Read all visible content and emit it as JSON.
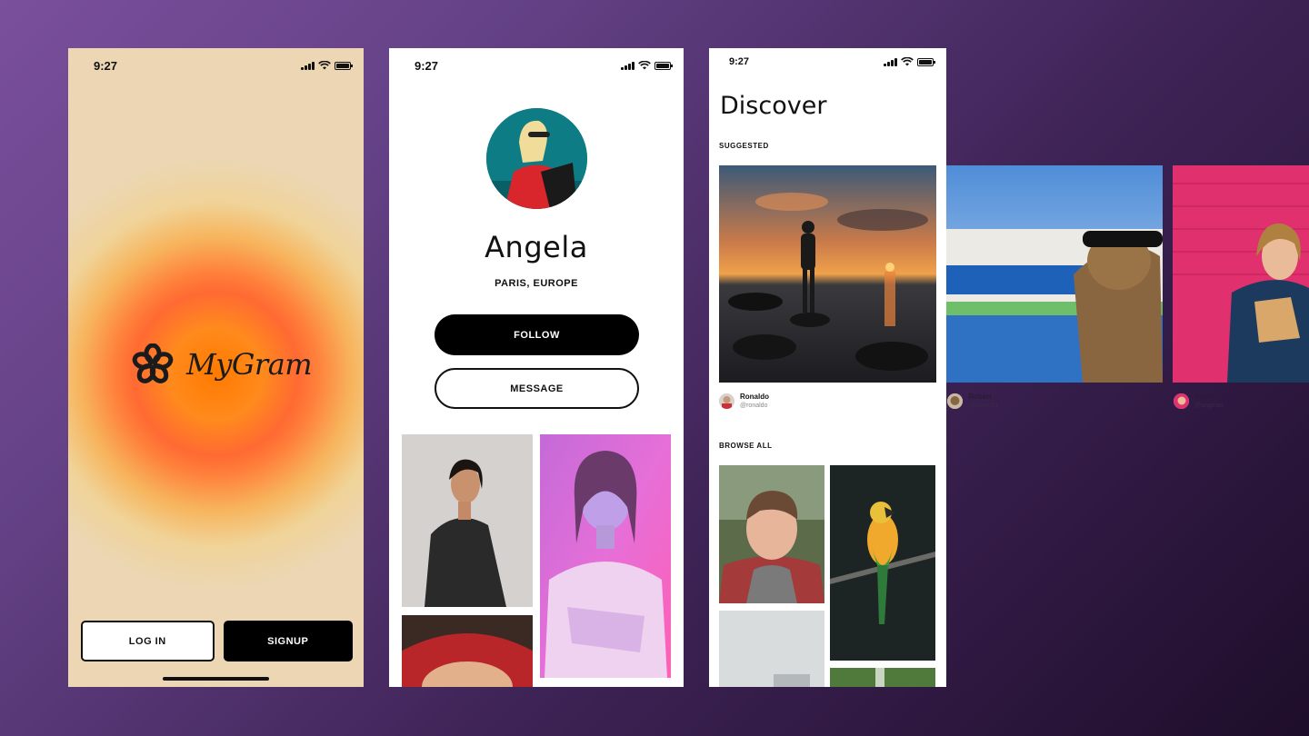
{
  "status": {
    "time": "9:27"
  },
  "welcome": {
    "app_name": "MyGram",
    "login_label": "LOG IN",
    "signup_label": "SIGNUP"
  },
  "profile": {
    "name": "Angela",
    "location": "PARIS, EUROPE",
    "follow_label": "FOLLOW",
    "message_label": "MESSAGE"
  },
  "discover": {
    "title": "Discover",
    "suggested_label": "SUGGESTED",
    "browse_label": "BROWSE ALL",
    "suggested": [
      {
        "name": "Ronaldo",
        "handle": "@ronaldo"
      },
      {
        "name": "Robert",
        "handle": "@robert21"
      },
      {
        "name": "Angela",
        "handle": "@angelas"
      }
    ]
  },
  "colors": {
    "background": "#654287",
    "primary": "#000000",
    "welcome_bg": "#ecd6b3",
    "glow": "#ff7a00"
  }
}
